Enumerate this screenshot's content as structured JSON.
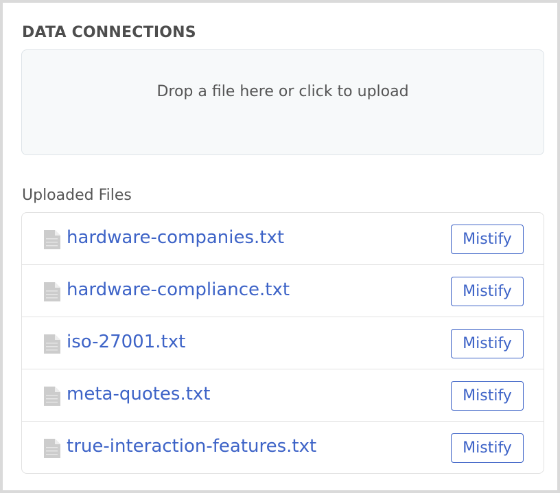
{
  "section": {
    "title": "DATA CONNECTIONS"
  },
  "dropzone": {
    "text": "Drop a file here or click to upload"
  },
  "uploaded": {
    "heading": "Uploaded Files",
    "action_label": "Mistify",
    "file_icon": "file-icon",
    "files": [
      {
        "name": "hardware-companies.txt"
      },
      {
        "name": "hardware-compliance.txt"
      },
      {
        "name": "iso-27001.txt"
      },
      {
        "name": "meta-quotes.txt"
      },
      {
        "name": "true-interaction-features.txt"
      }
    ]
  },
  "colors": {
    "link": "#3d63c7",
    "title": "#4d4d4d",
    "dropzone_bg": "#f7f9fa",
    "border": "#e1e1e1"
  }
}
